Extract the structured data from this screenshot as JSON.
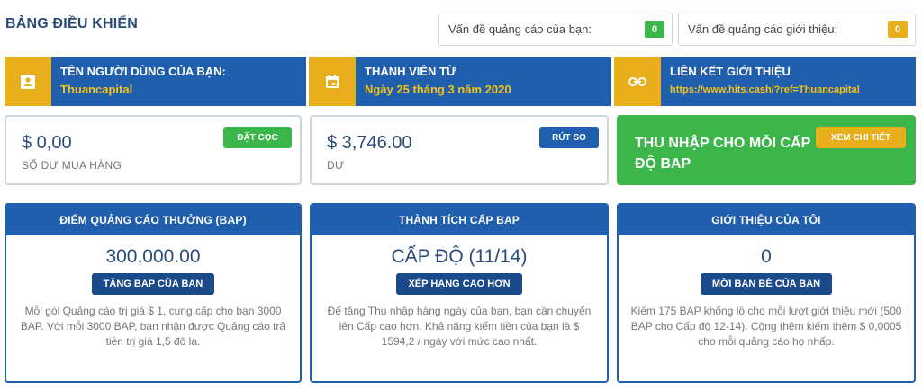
{
  "page_title": "BẢNG ĐIỀU KHIỂN",
  "issues": [
    {
      "label": "Vấn đề quảng cáo của bạn:",
      "count": "0",
      "color": "#3cb54a"
    },
    {
      "label": "Vấn đề quảng cáo giới thiệu:",
      "count": "0",
      "color": "#e9ae1b"
    }
  ],
  "info_cards": {
    "user": {
      "icon": "user-badge-icon",
      "title": "TÊN NGƯỜI DÙNG CỦA BẠN:",
      "value": "Thuancapital"
    },
    "member": {
      "icon": "calendar-icon",
      "title": "THÀNH VIÊN TỪ",
      "value": "Ngày 25 tháng 3 năm 2020"
    },
    "referral": {
      "icon": "link-icon",
      "title": "LIÊN KẾT GIỚI THIỆU",
      "value": "https://www.hits.cash/?ref=Thuancapital"
    }
  },
  "balances": {
    "purchase": {
      "amount": "$ 0,00",
      "label": "SỐ DƯ MUA HÀNG",
      "button": "ĐẶT CỌC"
    },
    "balance": {
      "amount": "$ 3,746.00",
      "label": "DƯ",
      "button": "RÚT SO"
    },
    "earnings": {
      "title": "THU NHẬP CHO MỖI CẤP ĐỘ BAP",
      "button": "XEM CHI TIẾT"
    }
  },
  "stats": {
    "bap_points": {
      "header": "ĐIỂM QUẢNG CÁO THƯỞNG (BAP)",
      "value": "300,000.00",
      "button": "TĂNG BAP CỦA BẠN",
      "description": "Mỗi gói Quảng cáo trị giá $ 1, cung cấp cho bạn 3000 BAP. Với mỗi 3000 BAP, bạn nhận được Quảng cáo trả tiền trị giá 1,5 đô la."
    },
    "bap_level": {
      "header": "THÀNH TÍCH CẤP BAP",
      "value": "CẤP ĐỘ (11/14)",
      "button": "XẾP HẠNG CAO HƠN",
      "description": "Để tăng Thu nhập hàng ngày của bạn, bạn cần chuyển lên Cấp cao hơn. Khả năng kiếm tiền của bạn là $ 1594,2 / ngày với mức cao nhất."
    },
    "referrals": {
      "header": "GIỚI THIỆU CỦA TÔI",
      "value": "0",
      "button": "MỜI BẠN BÈ CỦA BẠN",
      "description": "Kiếm 175 BAP khổng lồ cho mỗi lượt giới thiệu mới (500 BAP cho Cấp độ 12-14). Cộng thêm kiếm thêm $ 0,0005 cho mỗi quảng cáo họ nhấp."
    }
  }
}
